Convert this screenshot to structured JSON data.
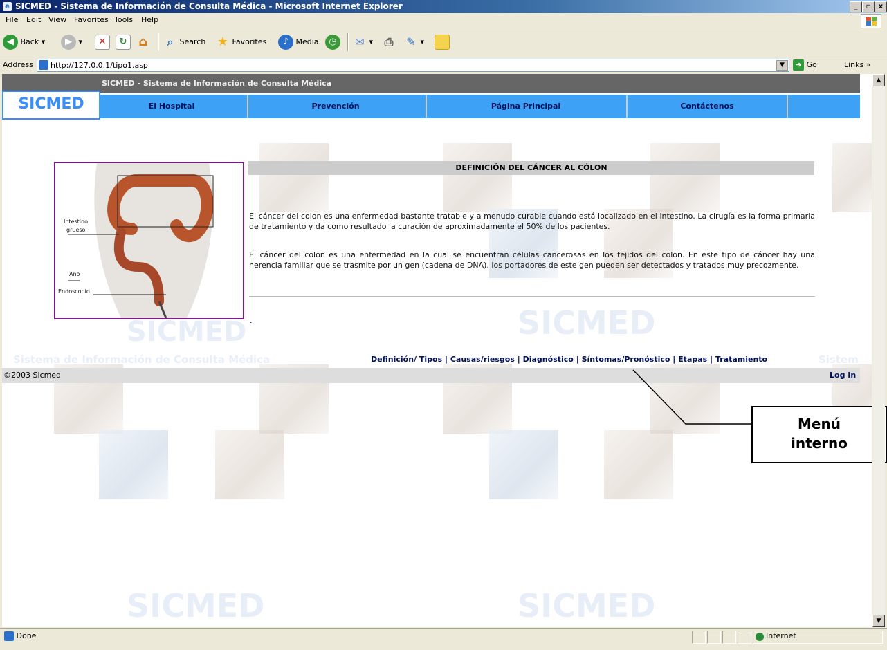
{
  "window": {
    "title": "SICMED - Sistema de Información de Consulta Médica - Microsoft Internet Explorer",
    "min": "_",
    "max": "▫",
    "close": "x"
  },
  "menu": {
    "items": [
      "File",
      "Edit",
      "View",
      "Favorites",
      "Tools",
      "Help"
    ]
  },
  "toolbar": {
    "back": "Back",
    "search": "Search",
    "favorites": "Favorites",
    "media": "Media"
  },
  "address": {
    "label": "Address",
    "url": "http://127.0.0.1/tipo1.asp",
    "go": "Go",
    "links": "Links »"
  },
  "page": {
    "header_title": "SICMED - Sistema de Información de Consulta Médica",
    "logo": "SICMED",
    "nav": [
      "El Hospital",
      "Prevención",
      "Página Principal",
      "Contáctenos"
    ],
    "image_labels": {
      "intestino": "Intestino",
      "grueso": "grueso",
      "ano": "Ano",
      "endoscopio": "Endoscopio"
    },
    "section_title": "DEFINICIÓN DEL CÁNCER AL CÓLON",
    "paragraph1": "El cáncer del colon es una enfermedad bastante tratable y a menudo curable cuando está localizado en el intestino. La cirugía es la forma primaria de tratamiento y da como resultado la curación de aproximadamente el 50% de los pacientes.",
    "paragraph2": "El cáncer del colon es una enfermedad en la cual se encuentran células cancerosas en los tejidos del colon. En este tipo de cáncer hay una herencia familiar que se trasmite por un gen (cadena de DNA), los portadores de este gen pueden ser detectados y tratados muy precozmente.",
    "dot": ".",
    "watermark_logo": "SICMED",
    "watermark_text": "Sistema de Información de Consulta Médica",
    "watermark_text_tail": "Sistem",
    "inner_menu": [
      "Definición/ Tipos",
      "Causas/riesgos",
      "Diagnóstico",
      "Síntomas/Pronóstico",
      "Etapas",
      "Tratamiento"
    ],
    "inner_menu_sep": "|",
    "copyright": "©2003 Sicmed",
    "login": "Log In"
  },
  "callout": {
    "line1": "Menú",
    "line2": "interno"
  },
  "status": {
    "text": "Done",
    "zone": "Internet"
  }
}
